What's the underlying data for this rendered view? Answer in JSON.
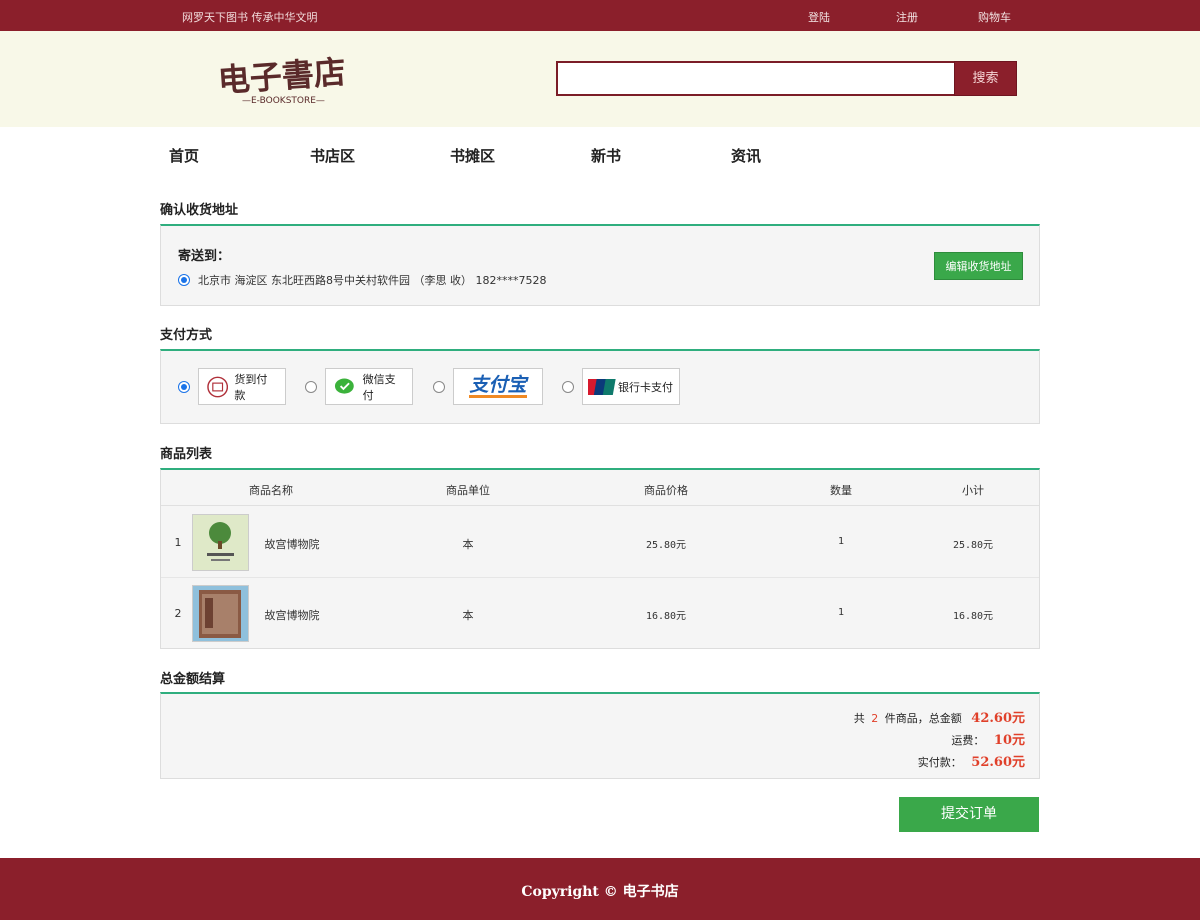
{
  "topbar": {
    "slogan": "网罗天下图书  传承中华文明",
    "login": "登陆",
    "register": "注册",
    "cart": "购物车"
  },
  "header": {
    "logo_text": "电子書店",
    "logo_sub": "—E-BOOKSTORE—",
    "search_placeholder": "",
    "search_button": "搜索"
  },
  "nav": {
    "items": [
      "首页",
      "书店区",
      "书摊区",
      "新书",
      "资讯"
    ]
  },
  "address": {
    "title": "确认收货地址",
    "ship_to": "寄送到：",
    "address_text": "北京市 海淀区 东北旺西路8号中关村软件园 （李思 收） 182****7528",
    "edit_button": "编辑收货地址"
  },
  "payment": {
    "title": "支付方式",
    "options": [
      "货到付款",
      "微信支付",
      "支付宝",
      "银行卡支付"
    ],
    "selected": "货到付款"
  },
  "products": {
    "title": "商品列表",
    "columns": [
      "商品名称",
      "商品单位",
      "商品价格",
      "数量",
      "小计"
    ],
    "rows": [
      {
        "index": "1",
        "name": "故宫博物院",
        "unit": "本",
        "price": "25.80元",
        "qty": "1",
        "subtotal": "25.80元"
      },
      {
        "index": "2",
        "name": "故宫博物院",
        "unit": "本",
        "price": "16.80元",
        "qty": "1",
        "subtotal": "16.80元"
      }
    ]
  },
  "summary": {
    "title": "总金额结算",
    "count_prefix": "共",
    "count": "2",
    "count_suffix": "件商品，总金额",
    "total": "42.60元",
    "shipping_label": "运费：",
    "shipping": "10元",
    "pay_label": "实付款：",
    "pay": "52.60元"
  },
  "submit_button": "提交订单",
  "footer": {
    "copyright": "Copyright © 电子书店"
  },
  "colors": {
    "brand": "#8b1f2b",
    "accent_green": "#3aa84a",
    "divider": "#2fae7e",
    "price": "#e0402a"
  }
}
